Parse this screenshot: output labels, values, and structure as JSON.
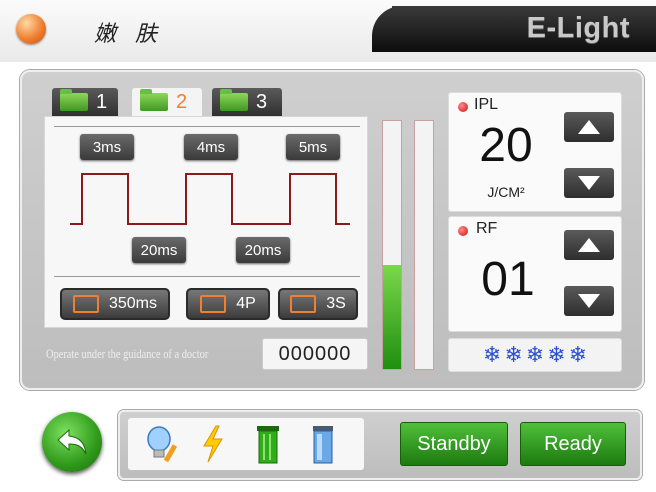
{
  "header": {
    "title": "嫩 肤",
    "brand": "E-Light"
  },
  "tabs": [
    {
      "label": "1",
      "active": false
    },
    {
      "label": "2",
      "active": true
    },
    {
      "label": "3",
      "active": false
    }
  ],
  "pulse": {
    "widths": [
      "3ms",
      "4ms",
      "5ms"
    ],
    "delays": [
      "20ms",
      "20ms"
    ]
  },
  "params": {
    "interval": "350ms",
    "pulses": "4P",
    "time": "3S"
  },
  "notice": "Operate under the guidance of a doctor",
  "counter": "000000",
  "bars": {
    "left_fill_fraction": 0.42,
    "right_fill_fraction": 0.0
  },
  "ipl": {
    "label": "IPL",
    "value": "20",
    "unit": "J/CM²"
  },
  "rf": {
    "label": "RF",
    "value": "01"
  },
  "cooling": {
    "level": 5,
    "icon": "snowflake-icon"
  },
  "bottom": {
    "icons": [
      "lightbulb-pencil-icon",
      "lightning-icon",
      "green-trash-icon",
      "blue-trash-icon"
    ],
    "standby_label": "Standby",
    "ready_label": "Ready"
  },
  "colors": {
    "accent": "#f08030",
    "green": "#2f9a1a",
    "pulse_line": "#8b1a1a"
  }
}
